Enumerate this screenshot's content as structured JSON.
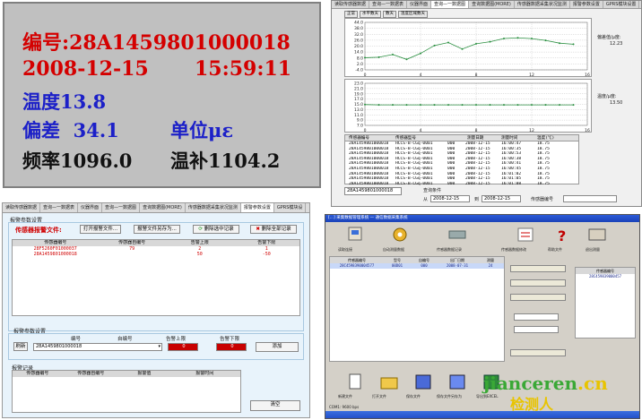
{
  "lcd": {
    "id_label": "编号:",
    "id_value": "28A1459801000018",
    "date": "2008-12-15",
    "time": "15:59:11",
    "temp_label": "温度",
    "temp_value": "13.8",
    "dev_label": "偏差",
    "dev_value": "34.1",
    "unit_label": "单位",
    "unit_value": "με",
    "freq_label": "频率",
    "freq_value": "1096.0",
    "comp_label": "温补",
    "comp_value": "1104.2"
  },
  "chart_window": {
    "tabs": [
      "读取传感器数据",
      "查询—一数据表",
      "仪器界面",
      "查询—一数据图",
      "查询数据图(MORE)",
      "传感器数据采集状况监测",
      "报警参数设置",
      "GPRS模块设置"
    ],
    "active_tab": 3,
    "sub_buttons": [
      "正常",
      "水平数天",
      "数天",
      "温度区域数天"
    ],
    "side1_label": "偏差值/μ度:",
    "side1_value": "12.23",
    "side2_label": "温度/μ度:",
    "side2_value": "13.50",
    "id_box": "28A1459801000018",
    "query_label": "查询条件",
    "from_label": "从",
    "from_date": "2008-12-15",
    "to_label": "到",
    "to_date": "2008-12-15",
    "sensor_label": "传感器编号",
    "table_headers": [
      "传感器编号",
      "传感器型号",
      "测量日期",
      "测量时间",
      "温度(℃)"
    ],
    "table_rows": [
      [
        "28A1459801000018",
        "HCCS-B-CGq-0001",
        "000",
        "2008-12-15",
        "16:00:47",
        "18.75"
      ],
      [
        "28A1459801000018",
        "HCCS-B-CGq-0001",
        "000",
        "2008-12-15",
        "16:00:35",
        "18.75"
      ],
      [
        "28A1459801000018",
        "HCCS-B-CGq-0001",
        "000",
        "2008-12-15",
        "16:00:53",
        "18.75"
      ],
      [
        "28A1459801000018",
        "HCCS-B-CGq-0001",
        "000",
        "2008-12-15",
        "16:00:38",
        "18.75"
      ],
      [
        "28A1459801000018",
        "HCCS-B-CGq-0001",
        "000",
        "2008-12-15",
        "16:00:41",
        "18.75"
      ],
      [
        "28A1459801000018",
        "HCCS-B-CGq-0001",
        "000",
        "2008-12-15",
        "16:00:45",
        "18.75"
      ],
      [
        "28A1459801000018",
        "HCCS-B-CGq-0001",
        "000",
        "2008-12-15",
        "16:01:02",
        "18.75"
      ],
      [
        "28A1459801000018",
        "HCCS-B-CGq-0001",
        "000",
        "2008-12-15",
        "16:01:05",
        "18.75"
      ],
      [
        "28A1459801000018",
        "HCCS-B-CGq-0001",
        "000",
        "2008-12-15",
        "16:01:08",
        "18.75"
      ]
    ]
  },
  "chart_data": [
    {
      "type": "line",
      "x": [
        0,
        1,
        2,
        3,
        4,
        5,
        6,
        7,
        8,
        9,
        10,
        11,
        12,
        13,
        14,
        15
      ],
      "values": [
        8.3,
        8.8,
        11.5,
        6.6,
        12.6,
        20.6,
        23.6,
        17.1,
        22.4,
        24.4,
        27.7,
        28.4,
        27.6,
        25.8,
        23.0,
        21.9
      ],
      "xticks": [
        0,
        4,
        8,
        12,
        16
      ],
      "yticks": [
        "44.0",
        "38.0",
        "32.0",
        "26.0",
        "20.0",
        "14.0",
        "8.0",
        "2.0",
        "-4.0"
      ],
      "xlim": [
        0,
        16
      ],
      "ylim": [
        -4,
        44
      ],
      "grid": true
    },
    {
      "type": "line",
      "x": [
        0,
        1,
        2,
        3,
        4,
        5,
        6,
        7,
        8,
        9,
        10,
        11,
        12,
        13,
        14,
        15
      ],
      "values": [
        14.9,
        14.8,
        14.8,
        14.8,
        14.8,
        14.8,
        14.8,
        14.8,
        14.8,
        14.8,
        14.8,
        14.8,
        14.8,
        14.8,
        14.8,
        14.8
      ],
      "xticks": [
        0,
        4,
        8,
        12,
        16
      ],
      "yticks": [
        "23.0",
        "21.0",
        "19.0",
        "17.0",
        "15.0",
        "13.0",
        "11.0",
        "9.0",
        "7.0"
      ],
      "xlim": [
        0,
        16
      ],
      "ylim": [
        7,
        23
      ],
      "grid": true
    }
  ],
  "alarm": {
    "tabs": [
      "读取传感器数据",
      "查询—一数据表",
      "仪器界面",
      "查询—一数据图",
      "查询数据图(MORE)",
      "传感器数据采集状况监测",
      "报警参数设置",
      "GPRS模块设"
    ],
    "section1": "报警参数设置",
    "header_title": "传感器报警文件:",
    "btn_open": "打开报警文件...",
    "btn_saveas": "报警文件另存为...",
    "btn_delete_sel": "删除选中记录",
    "btn_delete_all": "删除全部记录",
    "table_headers": [
      "传感器编号",
      "传感器自编号",
      "告警上限",
      "告警下限"
    ],
    "table_rows": [
      [
        "28F5260F01000037",
        "79",
        "2",
        "1"
      ],
      [
        "28A1459801000018",
        "",
        "50",
        "-50"
      ]
    ],
    "section2": "报警参数设置",
    "col_id": "编号",
    "col_self": "自编号",
    "col_upper": "告警上限",
    "col_lower": "告警下限",
    "btn_refresh": "刷新",
    "id_value": "28A1459801000018",
    "upper_value": "0",
    "lower_value": "0",
    "btn_add": "添加",
    "section3": "报警记录",
    "record_headers": [
      "传感器编号",
      "传感器自编号",
      "报警值",
      "报警时间"
    ],
    "btn_clear": "清空"
  },
  "desktop": {
    "title": "[...] 采集数据管理系统 — 通信数据采集系统",
    "toolbar": [
      "读取连接",
      "自动测量数据",
      "传感器数据记录",
      "传感器数据修改",
      "帮助文件",
      "退出测量"
    ],
    "id_value": "28C4598390004577",
    "list_headers": [
      "传感器编号",
      "型号",
      "自编号",
      "出厂日期",
      "测量"
    ],
    "list_row": [
      "28C4598390004577",
      "00D01",
      "000",
      "2008-07-31",
      "24"
    ],
    "bottom_buttons": [
      "新建文件",
      "打开文件",
      "保存文件",
      "保存文件另存为",
      "导出到EXCEL"
    ],
    "right_panel_title": "传感器编号",
    "right_list": [
      "28C459839000457"
    ],
    "status": "COM1: 9600 bps"
  },
  "watermark": {
    "brand": "jianceren",
    "tld": ".cn",
    "cn": "检测人"
  },
  "colors": {
    "lcd_red": "#d40000",
    "lcd_blue": "#1c20c8",
    "chart_line": "#2a8f40",
    "alarm_red": "#d00000",
    "watermark_green": "#3aa836",
    "watermark_yellow": "#e8c400"
  }
}
